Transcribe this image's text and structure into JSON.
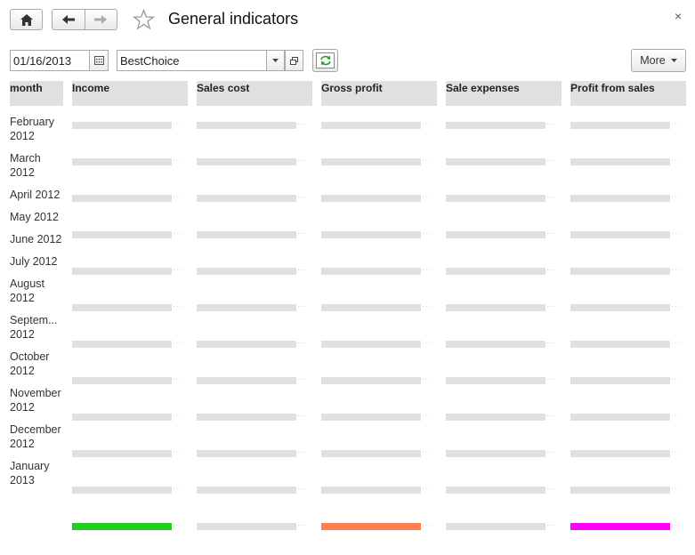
{
  "title": "General indicators",
  "toolbar": {
    "date_value": "01/16/2013",
    "organization_value": "BestChoice",
    "more_label": "More"
  },
  "columns": [
    "month",
    "Income",
    "Sales cost",
    "Gross profit",
    "Sale expenses",
    "Profit from sales"
  ],
  "months": [
    [
      "February",
      "2012"
    ],
    [
      "March",
      "2012"
    ],
    [
      "April 2012"
    ],
    [
      "May 2012"
    ],
    [
      "June 2012"
    ],
    [
      "July 2012"
    ],
    [
      "August",
      "2012"
    ],
    [
      "Septem...",
      "2012"
    ],
    [
      "October",
      "2012"
    ],
    [
      "November",
      "2012"
    ],
    [
      "December",
      "2012"
    ],
    [
      "January",
      "2013"
    ]
  ],
  "total_bar_colors": [
    "#22cc22",
    "#e0e0e0",
    "#ff7f50",
    "#e0e0e0",
    "#ff00ff"
  ],
  "empty_bar_color": "#e0e0e0"
}
